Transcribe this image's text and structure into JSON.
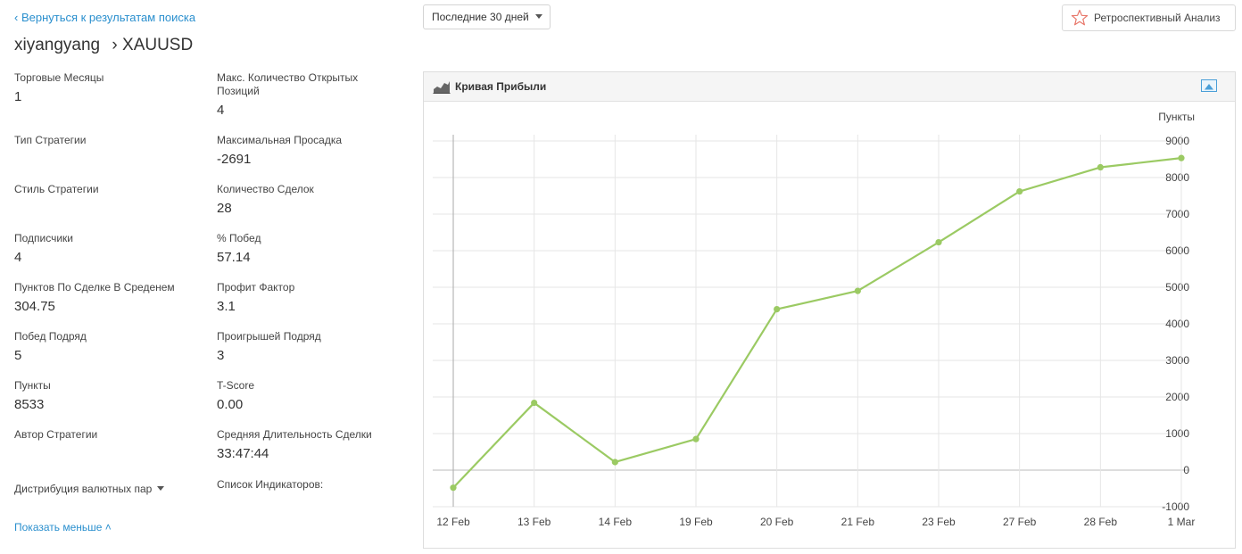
{
  "nav": {
    "back_label": "‹ Вернуться к результатам поиска"
  },
  "title": {
    "user": "xiyangyang",
    "separator": "›",
    "symbol": "XAUUSD"
  },
  "period_select": {
    "selected": "Последние 30 дней"
  },
  "retro_button": {
    "label": "Ретроспективный Анализ",
    "icon": "star-icon"
  },
  "stats_left": [
    {
      "label": "Торговые Месяцы",
      "value": "1"
    },
    {
      "label": "Тип Стратегии",
      "value": ""
    },
    {
      "label": "Стиль Стратегии",
      "value": ""
    },
    {
      "label": "Подписчики",
      "value": "4"
    },
    {
      "label": "Пунктов По Сделке В Среденем",
      "value": "304.75"
    },
    {
      "label": "Побед Подряд",
      "value": "5"
    },
    {
      "label": "Пункты",
      "value": "8533"
    },
    {
      "label": "Автор Стратегии",
      "value": ""
    }
  ],
  "stats_right": [
    {
      "label": "Макс. Количество Открытых Позиций",
      "value": "4"
    },
    {
      "label": "Максимальная Просадка",
      "value": "-2691"
    },
    {
      "label": "Количество Сделок",
      "value": "28"
    },
    {
      "label": "% Побед",
      "value": "57.14"
    },
    {
      "label": "Профит Фактор",
      "value": "3.1"
    },
    {
      "label": "Проигрышей Подряд",
      "value": "3"
    },
    {
      "label": "T-Score",
      "value": "0.00"
    },
    {
      "label": "Средняя Длительность Сделки",
      "value": "33:47:44"
    }
  ],
  "distribution": {
    "label": "Дистрибуция валютных пар"
  },
  "indicators": {
    "label": "Список Индикаторов:"
  },
  "show_less": {
    "label": "Показать меньше ˄"
  },
  "chart_panel": {
    "title": "Кривая Прибыли",
    "icon": "area-chart-icon",
    "expand_icon": "expand-icon"
  },
  "chart_data": {
    "type": "line",
    "title": "Кривая Прибыли",
    "ylabel": "Пункты",
    "xlabel": "",
    "categories": [
      "12 Feb",
      "13 Feb",
      "14 Feb",
      "19 Feb",
      "20 Feb",
      "21 Feb",
      "23 Feb",
      "27 Feb",
      "28 Feb",
      "1 Mar"
    ],
    "series": [
      {
        "values": [
          -480,
          1840,
          220,
          850,
          4400,
          4900,
          6230,
          7620,
          8280,
          8533
        ]
      }
    ],
    "ylim": [
      -1000,
      9000
    ],
    "yticks": [
      -1000,
      0,
      1000,
      2000,
      3000,
      4000,
      5000,
      6000,
      7000,
      8000,
      9000
    ],
    "grid": true,
    "y_axis_position": "right",
    "line_color": "#9bca63"
  }
}
